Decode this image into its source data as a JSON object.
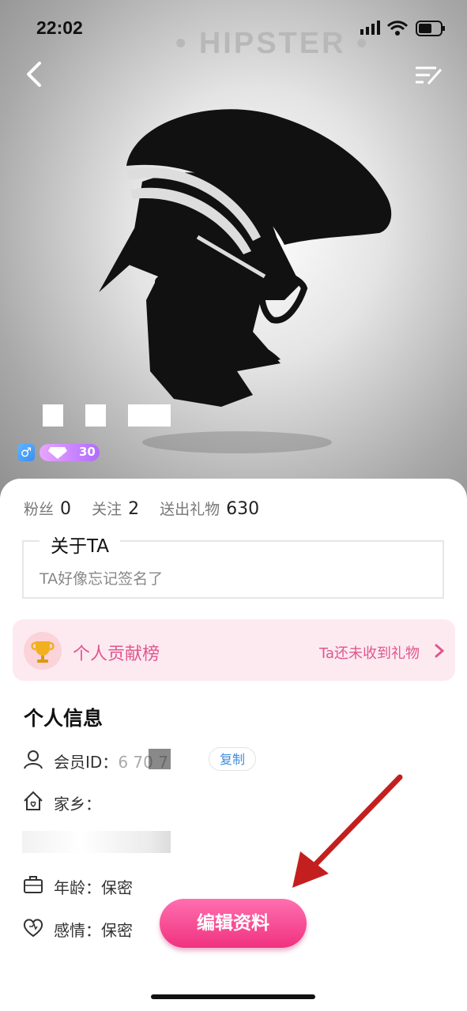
{
  "status_bar": {
    "time": "22:02"
  },
  "hero": {
    "watermark_text": "• HIPSTER •",
    "level": "30"
  },
  "stats": [
    {
      "label": "粉丝",
      "value": "0"
    },
    {
      "label": "关注",
      "value": "2"
    },
    {
      "label": "送出礼物",
      "value": "630"
    }
  ],
  "about": {
    "title": "关于TA",
    "signature": "TA好像忘记签名了"
  },
  "contribution": {
    "title": "个人贡献榜",
    "status": "Ta还未收到礼物"
  },
  "personal_info": {
    "title": "个人信息",
    "member_id_label": "会员ID：",
    "member_id_value": "6    70  7",
    "copy_label": "复制",
    "hometown_label": "家乡：",
    "age_label": "年龄：保密",
    "relationship_label": "感情：保密"
  },
  "edit_button_label": "编辑资料",
  "colors": {
    "accent_pink": "#f0327f",
    "contrib_text": "#e0578d",
    "copy_blue": "#3e8de0"
  }
}
